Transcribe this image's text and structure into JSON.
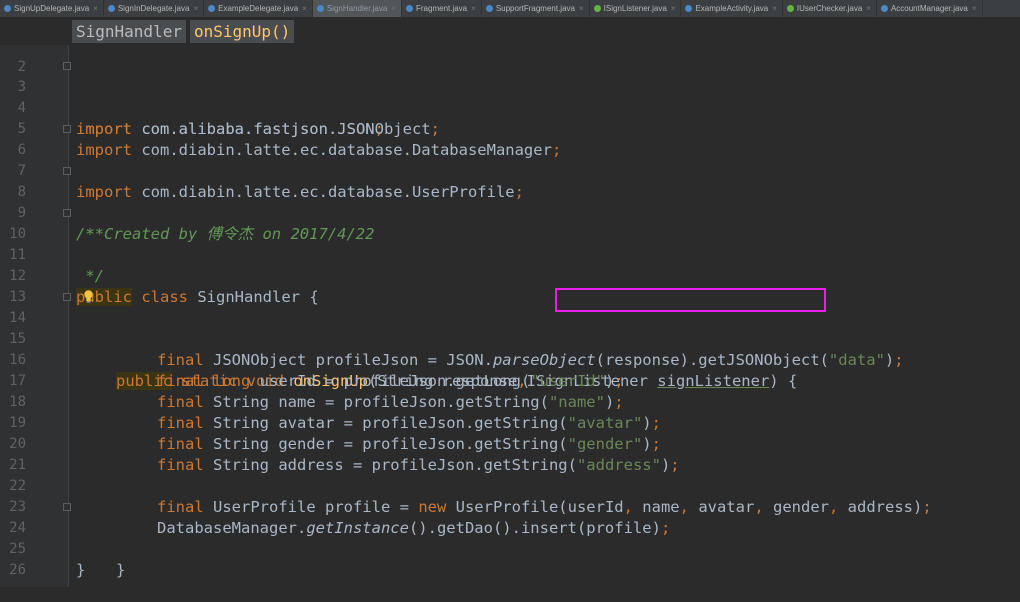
{
  "tabs": [
    {
      "label": "SignUpDelegate.java",
      "icon": "java-class-icon",
      "active": false
    },
    {
      "label": "SignInDelegate.java",
      "icon": "java-class-icon",
      "active": false
    },
    {
      "label": "ExampleDelegate.java",
      "icon": "java-class-icon",
      "active": false
    },
    {
      "label": "SignHandler.java",
      "icon": "java-class-icon",
      "active": true
    },
    {
      "label": "Fragment.java",
      "icon": "java-class-icon",
      "active": false
    },
    {
      "label": "SupportFragment.java",
      "icon": "java-class-icon",
      "active": false
    },
    {
      "label": "ISignListener.java",
      "icon": "java-interface-icon",
      "active": false
    },
    {
      "label": "ExampleActivity.java",
      "icon": "java-class-icon",
      "active": false
    },
    {
      "label": "IUserChecker.java",
      "icon": "java-interface-icon",
      "active": false
    },
    {
      "label": "AccountManager.java",
      "icon": "java-class-icon",
      "active": false
    }
  ],
  "tab_close_glyph": "×",
  "breadcrumb": {
    "class_name": "SignHandler",
    "method_name": "onSignUp()"
  },
  "line_numbers": [
    "2",
    "3",
    "4",
    "5",
    "6",
    "7",
    "8",
    "9",
    "10",
    "11",
    "12",
    "13",
    "14",
    "15",
    "16",
    "17",
    "18",
    "19",
    "20",
    "21",
    "22",
    "23",
    "24",
    "25",
    "26"
  ],
  "code": {
    "l3": {
      "kw": "import",
      "rest": " com.alibaba.fastjson.JSON",
      "semi": ";"
    },
    "l4": {
      "kw": "import",
      "rest": " com.alibaba.fastjson.JSONObject",
      "semi": ";"
    },
    "l5": {
      "kw": "import",
      "rest": " com.diabin.latte.ec.database.DatabaseManager",
      "semi": ";"
    },
    "l6": {
      "kw": "import",
      "rest": " com.diabin.latte.ec.database.UserProfile",
      "semi": ";"
    },
    "l8": "/**",
    "l9": " * Created by 傅令杰 on 2017/4/22",
    "l10": " */",
    "l12": {
      "kw1": "public",
      "kw2": " class",
      "rest": " SignHandler {"
    },
    "l14": {
      "kw1": "public",
      "kw2": " static void",
      "fn": " onSignUp",
      "p1": "(String response",
      "comma": ",",
      "p2": "ISignListener ",
      "param": "signListener",
      "close": ") {"
    },
    "l15": {
      "kw": "final",
      "a": " JSONObject profileJson = JSON.",
      "it": "parseObject",
      "b": "(response).getJSONObject(",
      "st": "\"data\"",
      "c": ")",
      "semi": ";"
    },
    "l16": {
      "kw": "final",
      "kw2": " long",
      "a": " userId = profileJson.getLong(",
      "st": "\"userId\"",
      "c": ")",
      "semi": ";"
    },
    "l17": {
      "kw": "final",
      "a": " String name = profileJson.getString(",
      "st": "\"name\"",
      "c": ")",
      "semi": ";"
    },
    "l18": {
      "kw": "final",
      "a": " String avatar = profileJson.getString(",
      "st": "\"avatar\"",
      "c": ")",
      "semi": ";"
    },
    "l19": {
      "kw": "final",
      "a": " String gender = profileJson.getString(",
      "st": "\"gender\"",
      "c": ")",
      "semi": ";"
    },
    "l20": {
      "kw": "final",
      "a": " String address = profileJson.getString(",
      "st": "\"address\"",
      "c": ")",
      "semi": ";"
    },
    "l22": {
      "kw": "final",
      "a": " UserProfile profile = ",
      "kw2": "new",
      "b": " UserProfile(userId",
      "c1": ",",
      "b2": " name",
      "c2": ",",
      "b3": " avatar",
      "c3": ",",
      "b4": " gender",
      "c4": ",",
      "b5": " address)",
      "semi": ";"
    },
    "l23": {
      "a": "DatabaseManager.",
      "it": "getInstance",
      "b": "().getDao().insert(profile)",
      "semi": ";"
    },
    "l24": "}",
    "l25": "}"
  },
  "colors": {
    "keyword": "#cc7832",
    "comment": "#629755",
    "string": "#6a8759",
    "method": "#ffc66d",
    "text": "#a9b7c6",
    "highlight_box": "#e81fe8"
  }
}
